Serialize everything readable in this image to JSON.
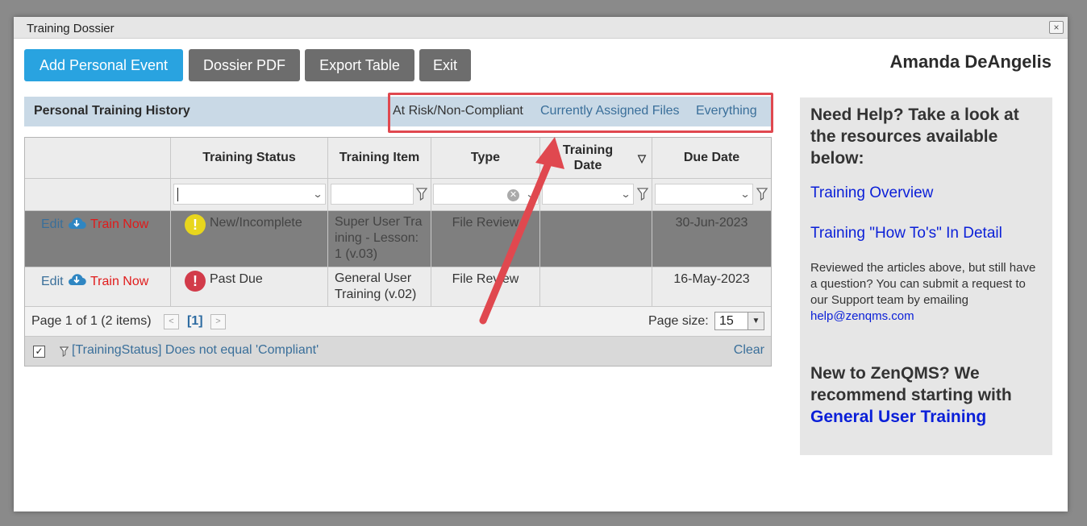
{
  "window": {
    "title": "Training Dossier",
    "close_glyph": "×"
  },
  "toolbar": {
    "add_event": "Add Personal Event",
    "dossier_pdf": "Dossier PDF",
    "export_table": "Export Table",
    "exit": "Exit"
  },
  "user": {
    "name": "Amanda DeAngelis"
  },
  "history": {
    "title": "Personal Training History",
    "filters": [
      "At Risk/Non-Compliant",
      "Currently Assigned Files",
      "Everything"
    ],
    "active_filter": "At Risk/Non-Compliant"
  },
  "grid": {
    "columns": [
      "Training Status",
      "Training Item",
      "Type",
      "Training Date",
      "Due Date"
    ],
    "sort_indicator": "▽",
    "rows": [
      {
        "edit": "Edit",
        "train": "Train Now",
        "status": "New/Incomplete",
        "status_icon": "warning-icon",
        "item": "Super User Training - Lesson:1 (v.03)",
        "type": "File Review",
        "training_date": "",
        "due_date": "30-Jun-2023"
      },
      {
        "edit": "Edit",
        "train": "Train Now",
        "status": "Past Due",
        "status_icon": "error-icon",
        "item": "General User Training (v.02)",
        "type": "File Review",
        "training_date": "",
        "due_date": "16-May-2023"
      }
    ],
    "pager": {
      "summary": "Page 1 of 1 (2 items)",
      "current": "[1]",
      "page_size_label": "Page size:",
      "page_size": "15"
    },
    "filter_footer": {
      "expression": "[TrainingStatus] Does not equal 'Compliant'",
      "clear": "Clear",
      "checked": true
    }
  },
  "help": {
    "heading": "Need Help? Take a look at the resources available below:",
    "links": [
      "Training Overview",
      "Training \"How To's\" In Detail"
    ],
    "support_text": "Reviewed the articles above, but still have a question? You can submit a request to our Support team by emailing ",
    "support_email": "help@zenqms.com",
    "new_heading": "New to ZenQMS? We recommend starting with ",
    "new_link": "General User Training"
  },
  "colors": {
    "primary_button": "#29a3e0",
    "secondary_button": "#6d6d6d",
    "link": "#3a6f9a",
    "train_now": "#e01b1b",
    "highlight": "#e0484f",
    "help_link": "#0a1fd8"
  }
}
